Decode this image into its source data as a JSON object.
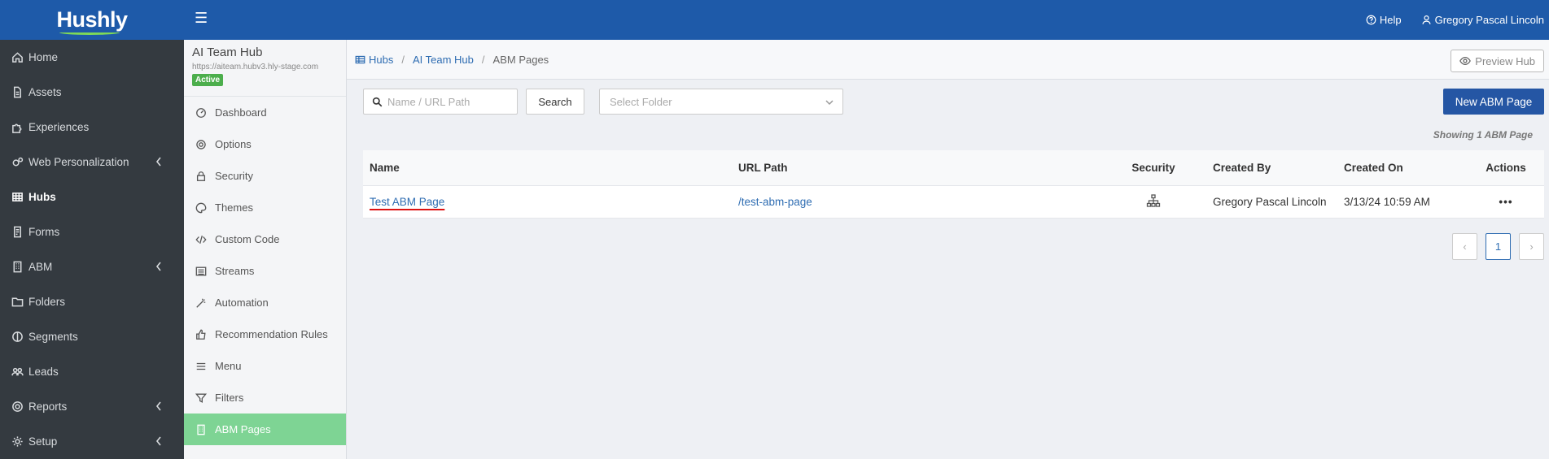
{
  "app": {
    "logo": "Hushly"
  },
  "topbar": {
    "help_label": "Help",
    "user_name": "Gregory Pascal Lincoln"
  },
  "leftnav": {
    "items": [
      {
        "label": "Home",
        "icon": "home-icon"
      },
      {
        "label": "Assets",
        "icon": "file-icon"
      },
      {
        "label": "Experiences",
        "icon": "puzzle-icon"
      },
      {
        "label": "Web Personalization",
        "icon": "gear-cluster-icon",
        "expandable": true
      },
      {
        "label": "Hubs",
        "icon": "grid-icon",
        "active": true
      },
      {
        "label": "Forms",
        "icon": "form-icon"
      },
      {
        "label": "ABM",
        "icon": "building-icon",
        "expandable": true
      },
      {
        "label": "Folders",
        "icon": "folder-icon"
      },
      {
        "label": "Segments",
        "icon": "segments-icon"
      },
      {
        "label": "Leads",
        "icon": "users-icon"
      },
      {
        "label": "Reports",
        "icon": "reports-icon",
        "expandable": true
      },
      {
        "label": "Setup",
        "icon": "setup-gear-icon",
        "expandable": true
      }
    ]
  },
  "hub": {
    "title": "AI Team Hub",
    "url": "https://aiteam.hubv3.hly-stage.com",
    "status": "Active",
    "items": [
      {
        "label": "Dashboard"
      },
      {
        "label": "Options"
      },
      {
        "label": "Security"
      },
      {
        "label": "Themes"
      },
      {
        "label": "Custom Code"
      },
      {
        "label": "Streams"
      },
      {
        "label": "Automation"
      },
      {
        "label": "Recommendation Rules"
      },
      {
        "label": "Menu"
      },
      {
        "label": "Filters"
      },
      {
        "label": "ABM Pages",
        "active": true
      }
    ]
  },
  "breadcrumb": {
    "hubs": "Hubs",
    "hub": "AI Team Hub",
    "current": "ABM Pages"
  },
  "preview_label": "Preview Hub",
  "toolbar": {
    "search_placeholder": "Name / URL Path",
    "search_label": "Search",
    "folder_placeholder": "Select Folder",
    "new_label": "New ABM Page"
  },
  "showing": "Showing 1 ABM Page",
  "table": {
    "headers": {
      "name": "Name",
      "url": "URL Path",
      "security": "Security",
      "created_by": "Created By",
      "created_on": "Created On",
      "actions": "Actions"
    },
    "rows": [
      {
        "name": "Test ABM Page",
        "url": "/test-abm-page",
        "created_by": "Gregory Pascal Lincoln",
        "created_on": "3/13/24 10:59 AM",
        "actions": "•••"
      }
    ]
  },
  "pagination": {
    "prev": "‹",
    "current": "1",
    "next": "›"
  },
  "colors": {
    "topbar": "#1e5aa9",
    "sidebar": "#343a40",
    "accent": "#2556a4",
    "active_hub_item": "#7ed494"
  }
}
